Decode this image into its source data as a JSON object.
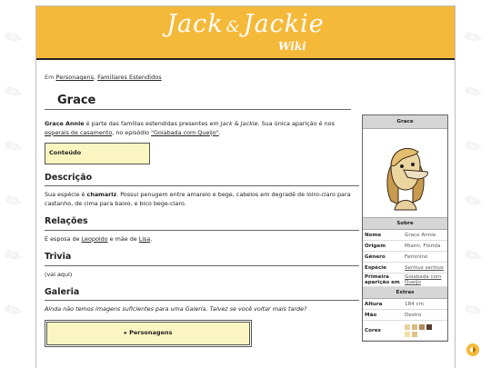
{
  "header": {
    "logo_text_left": "Jack",
    "logo_amp": "&",
    "logo_text_right": "Jackie",
    "logo_sub": "Wiki"
  },
  "breadcrumb": {
    "prefix": "Em",
    "items": [
      "Personagens",
      "Familiares Estendidos"
    ],
    "separator": ","
  },
  "page_title": "Grace",
  "intro": {
    "bold_name": "Grace Annie",
    "text1": " é parte das famílias estendidas presentes em ",
    "show_title": "Jack & Jackie",
    "text2": ". Sua única aparição é nos ",
    "link1": "esperais de casamento",
    "text3": ", no episódio ",
    "link2": "\"Goiabada com Queijo\"",
    "text4": "."
  },
  "toc_label": "Conteúdo",
  "sections": {
    "descricao": {
      "heading": "Descrição",
      "text_a": "Sua espécie é ",
      "bold": "chamariz",
      "text_b": ". Possui penugem entre amarelo e bege, cabelos em degradê de loiro-claro para castanho, de cima para baixo, e bico bege-claro."
    },
    "relacoes": {
      "heading": "Relações",
      "text_a": "É esposa de ",
      "link1": "Leopoldo",
      "text_b": " e mãe de ",
      "link2": "Lisa",
      "text_c": "."
    },
    "trivia": {
      "heading": "Trivia",
      "text": "(vai aqui)"
    },
    "galeria": {
      "heading": "Galeria",
      "text": "Ainda não temos imagens suficientes para uma Galeria. Talvez se você voltar mais tarde?"
    }
  },
  "navbox": {
    "arrow": "▸",
    "label": "Personagens"
  },
  "infobox": {
    "title": "Grace",
    "section_about": "Sobre",
    "rows": [
      {
        "k": "Nome",
        "v": "Grace Annie"
      },
      {
        "k": "Origem",
        "v": "Miami, Flórida"
      },
      {
        "k": "Gênero",
        "v": "Feminino"
      },
      {
        "k": "Espécie",
        "v": "Serinus serinus"
      },
      {
        "k": "Primeira aparição em",
        "v": "Goiabada com Queijo"
      }
    ],
    "section_extras": "Extras",
    "extras": [
      {
        "k": "Altura",
        "v": "184 cm"
      },
      {
        "k": "Mão",
        "v": "Destro"
      },
      {
        "k": "Cores",
        "v": ""
      }
    ],
    "colors": [
      "#e8cf9b",
      "#d8ba7c",
      "#b08a5a",
      "#5a3a2a",
      "#f2dfa6",
      "#e0c38c"
    ]
  }
}
